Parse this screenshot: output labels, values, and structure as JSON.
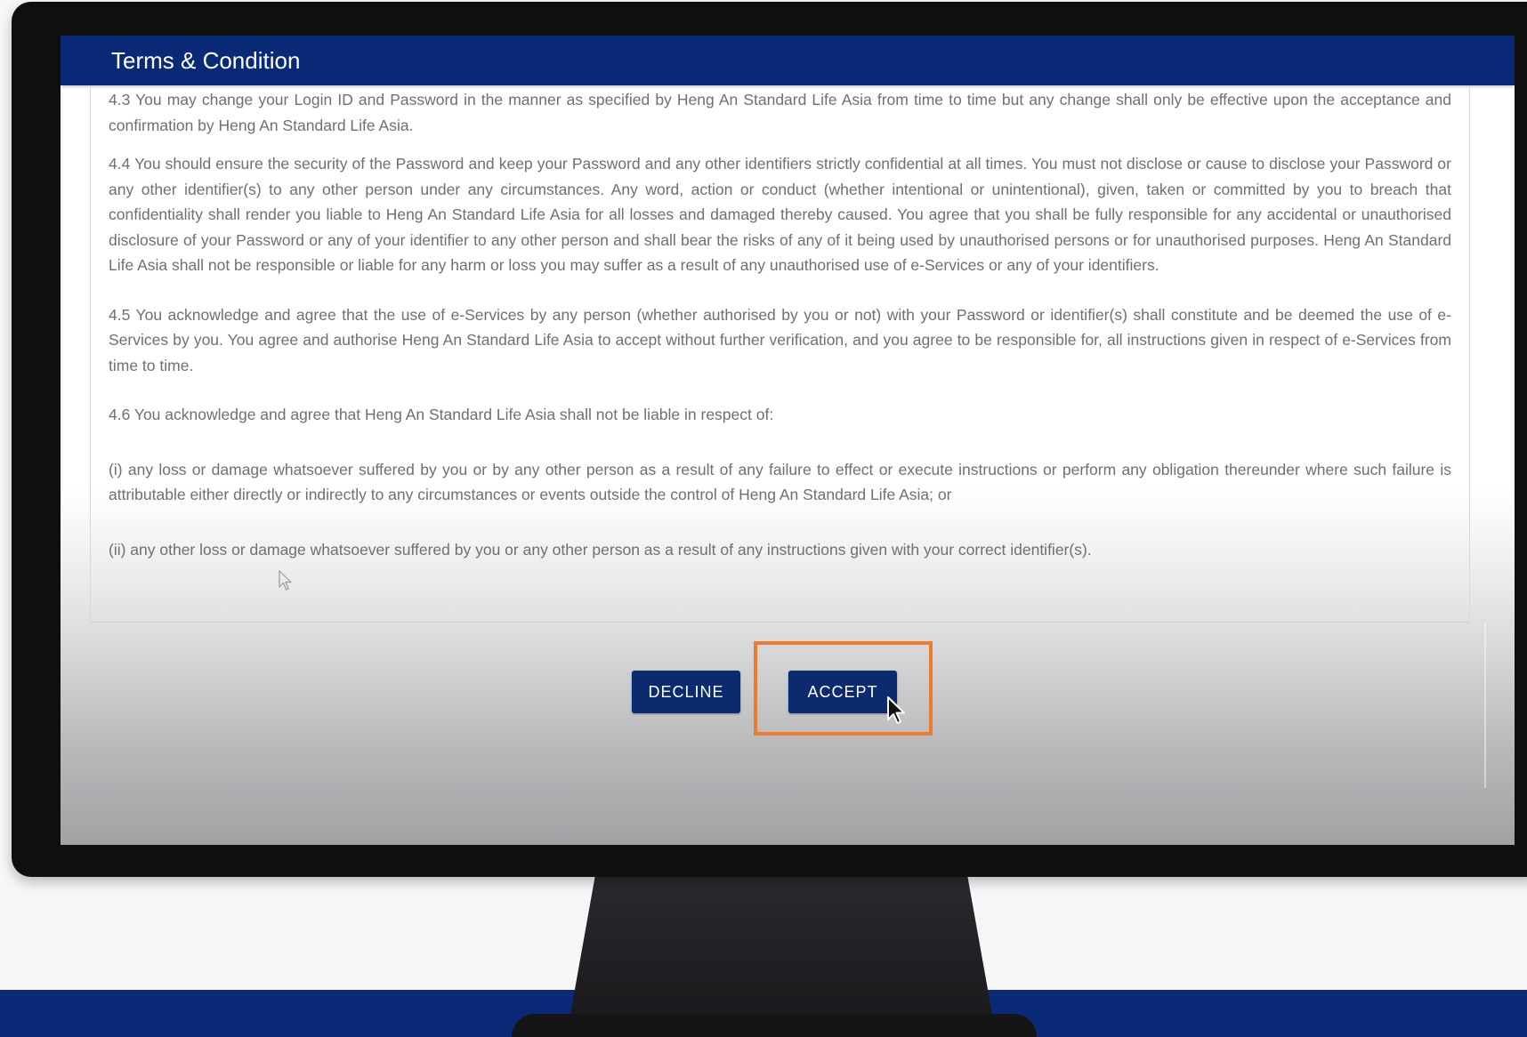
{
  "dialog": {
    "title": "Terms & Condition"
  },
  "terms": [
    "4.3 You may change your Login ID and Password in the manner as specified by Heng An Standard Life Asia from time to time but any change shall only be effective upon the acceptance and confirmation by Heng An Standard Life Asia.",
    "4.4 You should ensure the security of the Password and keep your Password and any other identifiers strictly confidential at all times. You must not disclose or cause to disclose your Password or any other identifier(s) to any other person under any circumstances. Any word, action or conduct (whether intentional or unintentional), given, taken or committed by you to breach that confidentiality shall render you liable to Heng An Standard Life Asia for all losses and damaged thereby caused. You agree that you shall be fully responsible for any accidental or unauthorised disclosure of your Password or any of your identifier to any other person and shall bear the risks of any of it being used by unauthorised persons or for unauthorised purposes. Heng An Standard Life Asia shall not be responsible or liable for any harm or loss you may suffer as a result of any unauthorised use of e-Services or any of your identifiers.",
    "4.5 You acknowledge and agree that the use of e-Services by any person (whether authorised by you or not) with your Password or identifier(s) shall constitute and be deemed the use of e-Services by you. You agree and authorise Heng An Standard Life Asia to accept without further verification, and you agree to be responsible for, all instructions given in respect of e-Services from time to time.",
    "4.6 You acknowledge and agree that Heng An Standard Life Asia shall not be liable in respect of:",
    "(i) any loss or damage whatsoever suffered by you or by any other person as a result of any failure to effect or execute instructions or perform any obligation thereunder where such failure is attributable either directly or indirectly to any circumstances or events outside the control of Heng An Standard Life Asia; or",
    "(ii) any other loss or damage whatsoever suffered by you or any other person as a result of any instructions given with your correct identifier(s)."
  ],
  "buttons": {
    "decline_label": "DECLINE",
    "accept_label": "ACCEPT"
  },
  "colors": {
    "brand_blue": "#0a2a78",
    "button_blue": "#0b2b6e",
    "highlight_orange": "#ea7b2f",
    "body_text": "#6f6f74"
  }
}
